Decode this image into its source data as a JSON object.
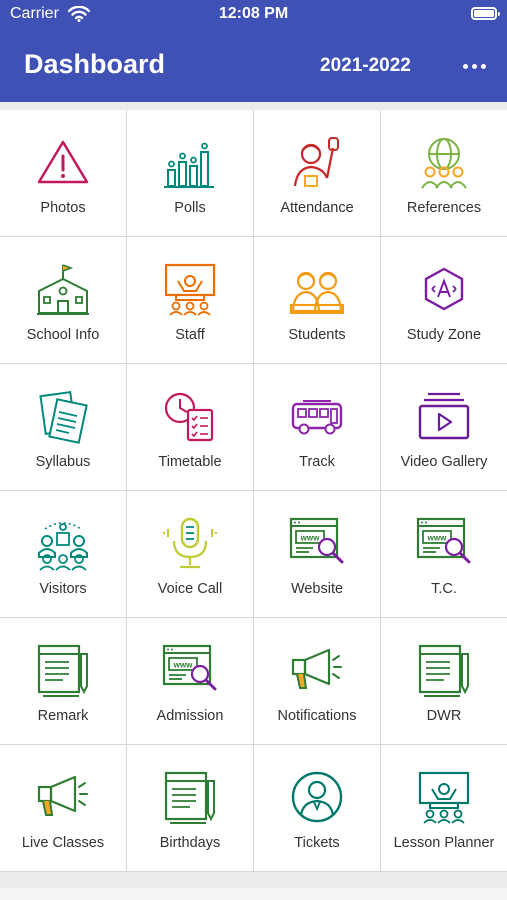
{
  "status_bar": {
    "carrier": "Carrier",
    "time": "12:08 PM"
  },
  "header": {
    "title": "Dashboard",
    "year": "2021-2022",
    "menu_icon": "more-horizontal-icon",
    "background": "#3f51b5"
  },
  "menu": [
    {
      "label": "Photos",
      "icon": "alert-icon",
      "color": "#c2185b"
    },
    {
      "label": "Polls",
      "icon": "poll-bars-icon",
      "color": "#00897b"
    },
    {
      "label": "Attendance",
      "icon": "raised-hand-person-icon",
      "color": "#c62828"
    },
    {
      "label": "References",
      "icon": "globe-people-icon",
      "color": "#7cb342"
    },
    {
      "label": "School Info",
      "icon": "school-building-icon",
      "color": "#2e7d32"
    },
    {
      "label": "Staff",
      "icon": "teacher-board-icon",
      "color": "#ef6c00"
    },
    {
      "label": "Students",
      "icon": "students-icon",
      "color": "#f39c12"
    },
    {
      "label": "Study Zone",
      "icon": "hexagon-letter-icon",
      "color": "#7b1fa2"
    },
    {
      "label": "Syllabus",
      "icon": "documents-icon",
      "color": "#00897b"
    },
    {
      "label": "Timetable",
      "icon": "clock-checklist-icon",
      "color": "#c2185b"
    },
    {
      "label": "Track",
      "icon": "bus-icon",
      "color": "#8e24aa"
    },
    {
      "label": "Video Gallery",
      "icon": "video-play-icon",
      "color": "#6a1b9a"
    },
    {
      "label": "Visitors",
      "icon": "visitors-group-icon",
      "color": "#00897b"
    },
    {
      "label": "Voice Call",
      "icon": "microphone-icon",
      "color": "#c0ca33"
    },
    {
      "label": "Website",
      "icon": "www-search-icon",
      "color": "#2e7d32"
    },
    {
      "label": "T.C.",
      "icon": "www-search-icon",
      "color": "#2e7d32"
    },
    {
      "label": "Remark",
      "icon": "notebook-pen-icon",
      "color": "#2e7d32"
    },
    {
      "label": "Admission",
      "icon": "www-search-icon",
      "color": "#2e7d32"
    },
    {
      "label": "Notifications",
      "icon": "megaphone-icon",
      "color": "#2e7d32"
    },
    {
      "label": "DWR",
      "icon": "notebook-pen-icon",
      "color": "#2e7d32"
    },
    {
      "label": "Live Classes",
      "icon": "megaphone-icon",
      "color": "#2e7d32"
    },
    {
      "label": "Birthdays",
      "icon": "notebook-pen-icon",
      "color": "#2e7d32"
    },
    {
      "label": "Tickets",
      "icon": "person-circle-icon",
      "color": "#00796b"
    },
    {
      "label": "Lesson Planner",
      "icon": "teacher-board-icon",
      "color": "#00796b"
    }
  ]
}
